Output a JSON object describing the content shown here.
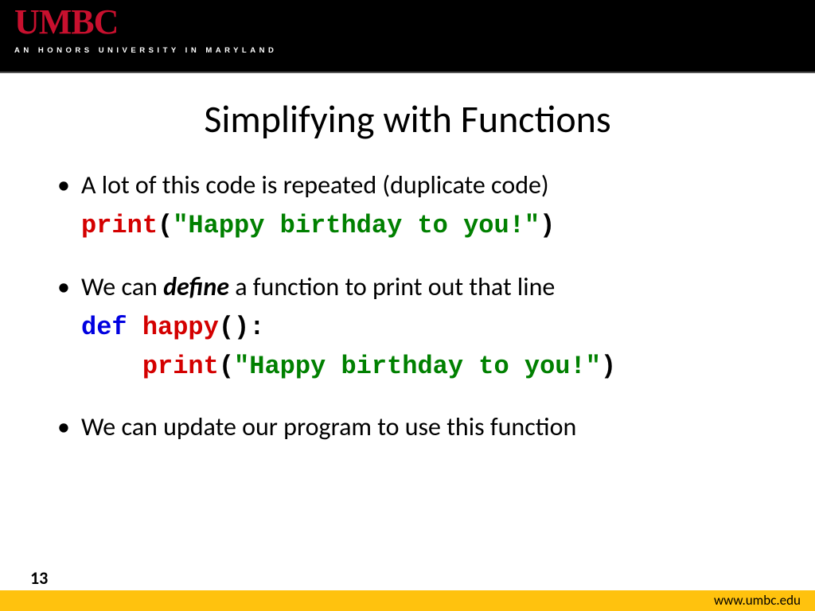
{
  "header": {
    "logo_main": "UMBC",
    "logo_tag": "AN HONORS UNIVERSITY IN MARYLAND"
  },
  "slide": {
    "title": "Simplifying with Functions",
    "bullets": {
      "b1": "A lot of this code is repeated (duplicate code)",
      "b2_pre": "We can ",
      "b2_emph": "define",
      "b2_post": " a function to print out that line",
      "b3": "We can update our program to use this function"
    },
    "code": {
      "print_kw": "print",
      "paren_open": "(",
      "string_happy": "\"Happy birthday to you!\"",
      "paren_close": ")",
      "def_kw": "def",
      "space": " ",
      "fn_name": "happy",
      "fn_sig_end": "():",
      "indent": "    "
    },
    "page_number": "13",
    "footer_url": "www.umbc.edu"
  }
}
